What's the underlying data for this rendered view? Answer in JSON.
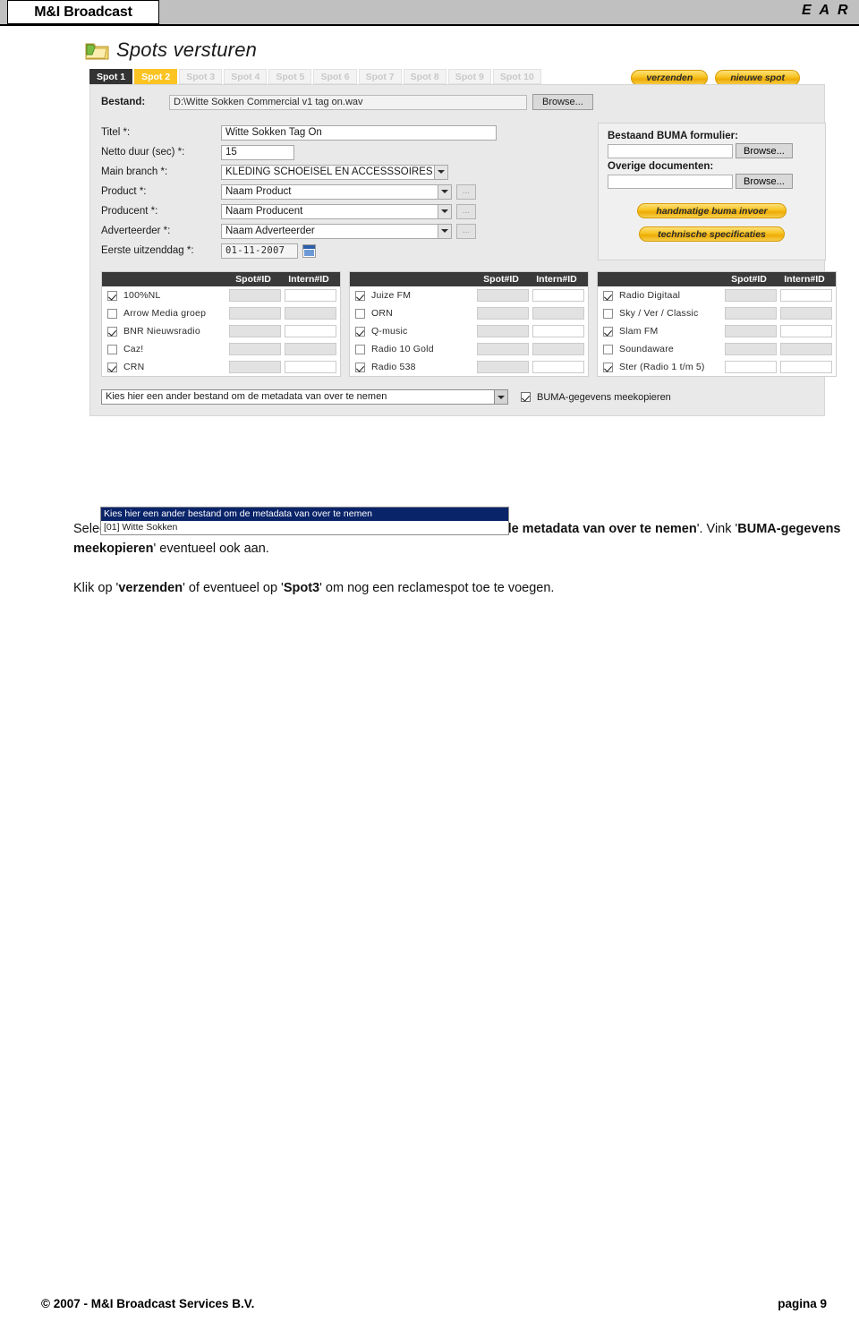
{
  "header": {
    "brand": "M&I Broadcast",
    "logo": "E A R"
  },
  "app": {
    "title": "Spots versturen",
    "folder_icon": "folder-icon",
    "tabs": [
      {
        "label": "Spot 1",
        "state": "dark"
      },
      {
        "label": "Spot 2",
        "state": "yellow"
      },
      {
        "label": "Spot 3",
        "state": "disabled"
      },
      {
        "label": "Spot 4",
        "state": "disabled"
      },
      {
        "label": "Spot 5",
        "state": "disabled"
      },
      {
        "label": "Spot 6",
        "state": "disabled"
      },
      {
        "label": "Spot 7",
        "state": "disabled"
      },
      {
        "label": "Spot 8",
        "state": "disabled"
      },
      {
        "label": "Spot 9",
        "state": "disabled"
      },
      {
        "label": "Spot 10",
        "state": "disabled"
      }
    ],
    "actions": {
      "send": "verzenden",
      "new_spot": "nieuwe spot"
    },
    "file_row": {
      "label": "Bestand:",
      "value": "D:\\Witte Sokken Commercial v1 tag on.wav",
      "browse": "Browse..."
    },
    "fields": {
      "titel_label": "Titel *:",
      "titel_value": "Witte Sokken Tag On",
      "duur_label": "Netto duur (sec) *:",
      "duur_value": "15",
      "branch_label": "Main branch *:",
      "branch_value": "KLEDING SCHOEISEL EN ACCESSSOIRES",
      "product_label": "Product *:",
      "product_value": "Naam Product",
      "producent_label": "Producent *:",
      "producent_value": "Naam Producent",
      "adverteerder_label": "Adverteerder *:",
      "adverteerder_value": "Naam Adverteerder",
      "uitzenddag_label": "Eerste uitzenddag *:",
      "uitzenddag_value": "01-11-2007",
      "dots": "...",
      "calendar_icon": "calendar-icon"
    },
    "buma": {
      "form_label": "Bestaand BUMA formulier:",
      "form_value": "",
      "form_browse": "Browse...",
      "docs_label": "Overige documenten:",
      "docs_value": "",
      "docs_browse": "Browse...",
      "manual_btn": "handmatige buma invoer",
      "tech_btn": "technische specificaties"
    },
    "stations": {
      "col_spot_id": "Spot#ID",
      "col_intern_id": "Intern#ID",
      "columns": [
        [
          {
            "name": "100%NL",
            "checked": true,
            "spot_open": false,
            "intern_open": true
          },
          {
            "name": "Arrow Media groep",
            "checked": false,
            "spot_open": false,
            "intern_open": false
          },
          {
            "name": "BNR Nieuwsradio",
            "checked": true,
            "spot_open": false,
            "intern_open": true
          },
          {
            "name": "Caz!",
            "checked": false,
            "spot_open": false,
            "intern_open": false
          },
          {
            "name": "CRN",
            "checked": true,
            "spot_open": false,
            "intern_open": true
          }
        ],
        [
          {
            "name": "Juize FM",
            "checked": true,
            "spot_open": false,
            "intern_open": true
          },
          {
            "name": "ORN",
            "checked": false,
            "spot_open": false,
            "intern_open": false
          },
          {
            "name": "Q-music",
            "checked": true,
            "spot_open": false,
            "intern_open": true
          },
          {
            "name": "Radio 10 Gold",
            "checked": false,
            "spot_open": false,
            "intern_open": false
          },
          {
            "name": "Radio 538",
            "checked": true,
            "spot_open": false,
            "intern_open": true
          }
        ],
        [
          {
            "name": "Radio Digitaal",
            "checked": true,
            "spot_open": false,
            "intern_open": true
          },
          {
            "name": "Sky / Ver / Classic",
            "checked": false,
            "spot_open": false,
            "intern_open": false
          },
          {
            "name": "Slam FM",
            "checked": true,
            "spot_open": false,
            "intern_open": true
          },
          {
            "name": "Soundaware",
            "checked": false,
            "spot_open": false,
            "intern_open": false
          },
          {
            "name": "Ster (Radio 1 t/m 5)",
            "checked": true,
            "spot_open": true,
            "intern_open": true
          }
        ]
      ]
    },
    "bottom": {
      "meta_select_value": "Kies hier een ander bestand om de metadata van over te nemen",
      "meta_options": [
        "Kies hier een ander bestand om de metadata van over te nemen",
        "[01] Witte Sokken"
      ],
      "buma_copy_label": "BUMA-gegevens meekopieren",
      "buma_copy_checked": true
    }
  },
  "body": {
    "p1_a": "Selecteer hiervoor onderaan de pagina '",
    "p1_b": "Kies hier een ander bestand om de metadata van over te nemen",
    "p1_c": "'. Vink '",
    "p1_d": "BUMA-gegevens meekopieren",
    "p1_e": "' eventueel ook aan.",
    "p2_a": "Klik op '",
    "p2_b": "verzenden",
    "p2_c": "' of eventueel op '",
    "p2_d": "Spot3",
    "p2_e": "' om nog een reclamespot toe te voegen."
  },
  "footer": {
    "copyright": "© 2007 - M&I Broadcast Services B.V.",
    "page": "pagina  9"
  }
}
